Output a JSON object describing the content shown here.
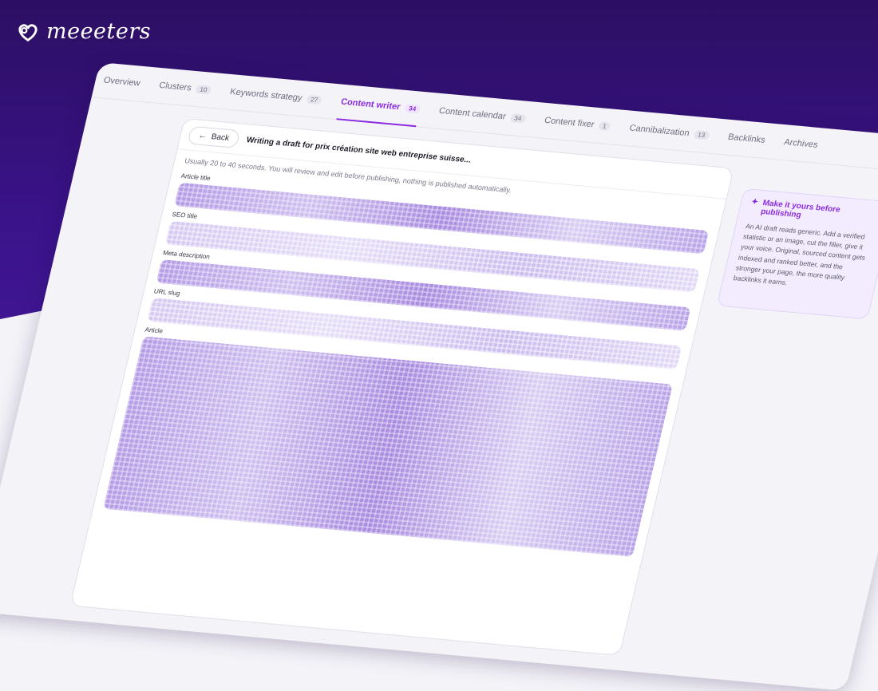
{
  "brand": {
    "name": "meeeters"
  },
  "tabs": [
    {
      "label": "Overview",
      "count": ""
    },
    {
      "label": "Clusters",
      "count": "10"
    },
    {
      "label": "Keywords strategy",
      "count": "27"
    },
    {
      "label": "Content writer",
      "count": "34",
      "active": true
    },
    {
      "label": "Content calendar",
      "count": "34"
    },
    {
      "label": "Content fixer",
      "count": "1"
    },
    {
      "label": "Cannibalization",
      "count": "13"
    },
    {
      "label": "Backlinks",
      "count": ""
    },
    {
      "label": "Archives",
      "count": ""
    }
  ],
  "panel": {
    "back_label": "Back",
    "title": "Writing a draft for prix création site web entreprise suisse...",
    "info": "Usually 20 to 40 seconds. You will review and edit before publishing, nothing is published automatically.",
    "fields": {
      "article_title": "Article title",
      "seo_title": "SEO title",
      "meta_description": "Meta description",
      "url_slug": "URL slug",
      "article": "Article"
    }
  },
  "tip": {
    "title": "Make it yours before publishing",
    "body": "An AI draft reads generic. Add a verified statistic or an image, cut the filler, give it your voice. Original, sourced content gets indexed and ranked better, and the stronger your page, the more quality backlinks it earns.",
    "icon": "magic-wand-icon"
  },
  "colors": {
    "accent": "#8a2be2",
    "header_bg": "#2c0f63"
  }
}
